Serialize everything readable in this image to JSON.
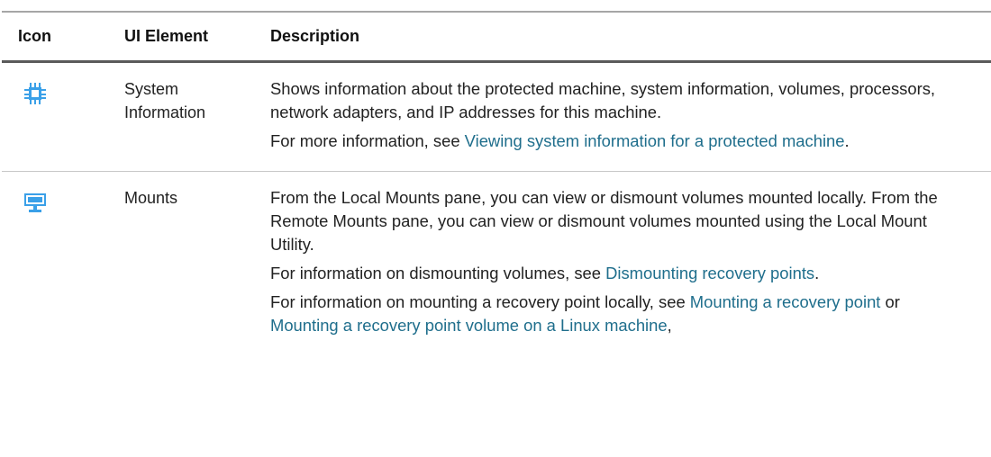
{
  "table": {
    "headers": {
      "icon": "Icon",
      "ui_element": "UI Element",
      "description": "Description"
    },
    "rows": [
      {
        "icon": "chip-icon",
        "element_line1": "System",
        "element_line2": "Information",
        "p1": "Shows information about the protected machine, system information, volumes, processors, network adapters, and IP addresses for this machine.",
        "p2_text": "For more information, see ",
        "p2_link": "Viewing system information for a protected machine",
        "p2_end": "."
      },
      {
        "icon": "monitor-icon",
        "element": "Mounts",
        "p1": "From the Local Mounts pane, you can view or dismount volumes mounted locally. From the Remote Mounts pane, you can view or dismount volumes mounted using the Local Mount Utility.",
        "p2_text": "For information on dismounting volumes, see ",
        "p2_link": "Dismounting recovery points",
        "p2_end": ".",
        "p3_text": "For information on mounting a recovery point locally, see ",
        "p3_link1": "Mounting a recovery point",
        "p3_mid": " or ",
        "p3_link2": "Mounting a recovery point volume on a Linux machine",
        "p3_end": ","
      }
    ]
  },
  "colors": {
    "link": "#1f6e8c",
    "icon_blue": "#3aa0e8"
  }
}
